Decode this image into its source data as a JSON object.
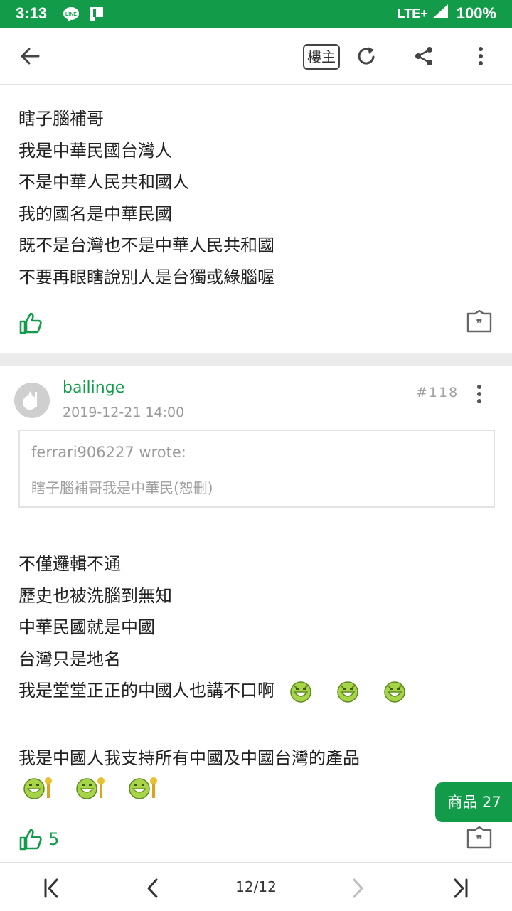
{
  "status_bar": {
    "time": "3:13",
    "network": "LTE+",
    "battery": "100%",
    "color": "#129c4a"
  },
  "toolbar": {
    "op_label": "樓主",
    "icons": [
      "back-arrow-icon",
      "refresh-icon",
      "share-icon",
      "more-vert-icon"
    ]
  },
  "post1": {
    "lines": [
      "瞎子腦補哥",
      "我是中華民國台灣人",
      "不是中華人民共和國人",
      "我的國名是中華民國",
      "既不是台灣也不是中華人民共和國",
      "不要再眼瞎說別人是台獨或綠腦喔"
    ]
  },
  "post2": {
    "username": "bailinge",
    "date": "2019-12-21 14:00",
    "floor": "#118",
    "quote": {
      "author": "ferrari906227 wrote:",
      "body": "瞎子腦補哥我是中華民(恕刪)"
    },
    "lines": [
      "不僅邏輯不通",
      "歷史也被洗腦到無知",
      "中華民國就是中國",
      "台灣只是地名",
      "我是堂堂正正的中國人也講不口啊"
    ],
    "line_after": "我是中國人我支持所有中國及中國台灣的產品",
    "like_count": "5"
  },
  "product_button": "商品 27",
  "bottom_nav": {
    "page": "12/12"
  },
  "accent_color": "#129c4a"
}
